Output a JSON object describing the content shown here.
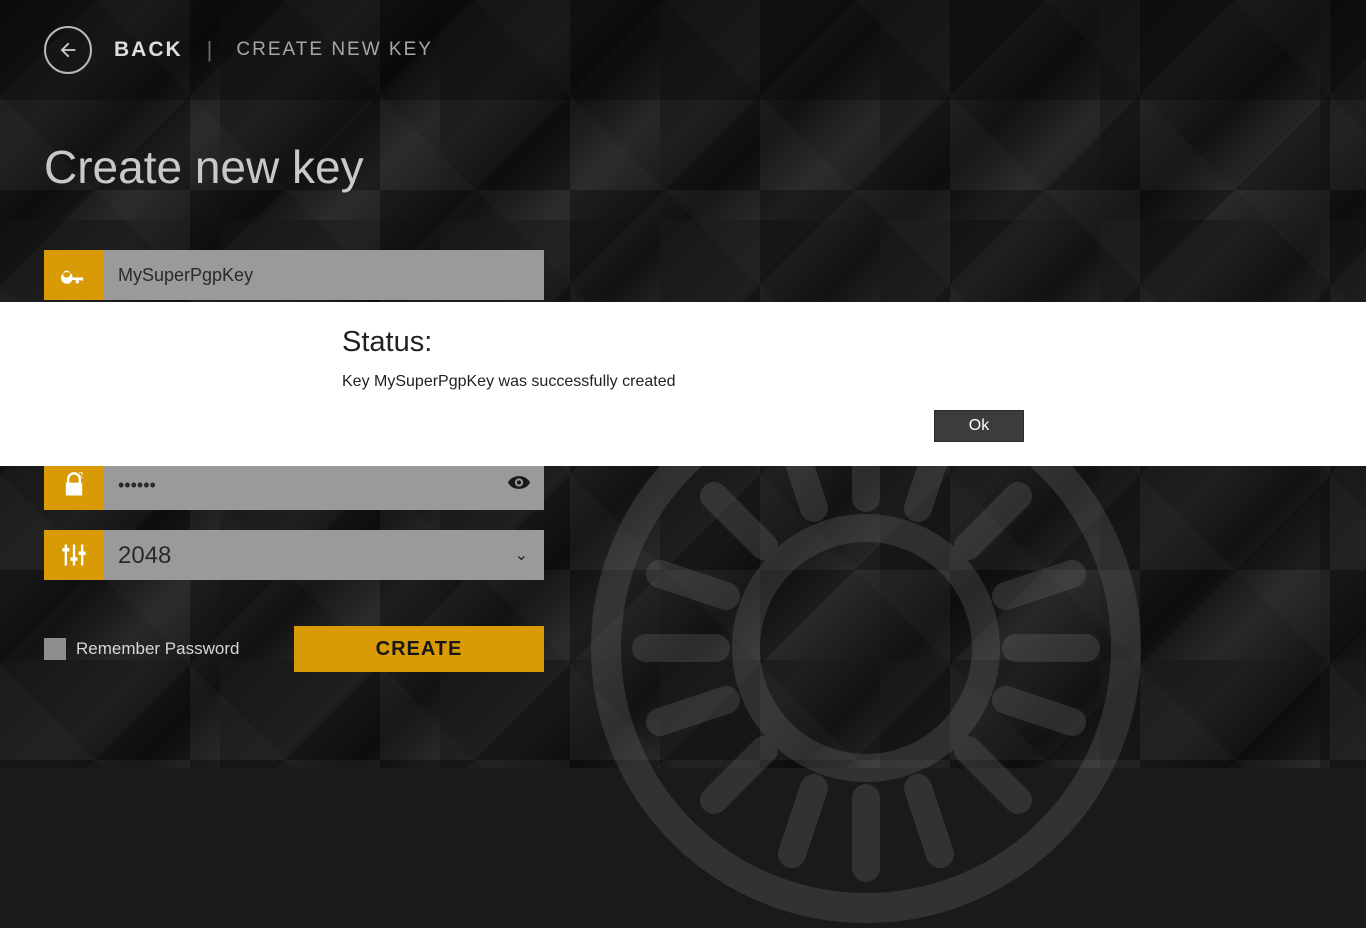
{
  "header": {
    "back_label": "BACK",
    "breadcrumb": "CREATE NEW KEY"
  },
  "page": {
    "title": "Create new key"
  },
  "form": {
    "key_name": {
      "value": "MySuperPgpKey"
    },
    "password": {
      "value": "••••••"
    },
    "confirm_password": {
      "value": "••••••"
    },
    "key_size": {
      "value": "2048"
    },
    "remember": {
      "label": "Remember Password"
    },
    "create_label": "CREATE"
  },
  "dialog": {
    "title": "Status:",
    "message": "Key MySuperPgpKey was successfully created",
    "ok_label": "Ok"
  },
  "colors": {
    "accent": "#d89b06"
  }
}
